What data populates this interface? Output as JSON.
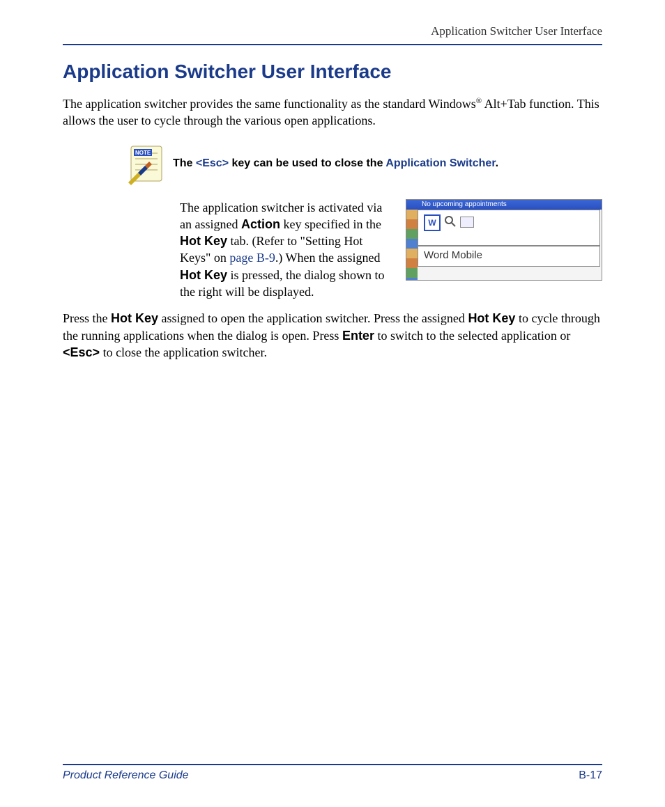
{
  "header": {
    "running_title": "Application Switcher User Interface"
  },
  "title": "Application Switcher User Interface",
  "intro": {
    "pre": "The application switcher provides the same functionality as the standard Win­dows",
    "reg": "®",
    "post": " Alt+Tab function. This allows the user to cycle through the various open applications."
  },
  "note": {
    "t1": "The ",
    "esc": "<Esc>",
    "t2": " key can be used to close the ",
    "appsw": "Application Switcher",
    "t3": "."
  },
  "para2": {
    "s1": "The application switcher is activated via an assigned ",
    "action": "Action",
    "s2": " key specified in the ",
    "hk1": "Hot Key",
    "s3": " tab. (Refer to \"Setting Hot Keys\" on ",
    "pageref": "page B-9",
    "s4": ".) When the assigned ",
    "hk2": "Hot Key",
    "s5": " is pressed, the dialog shown to the right will be displayed."
  },
  "screenshot": {
    "topbar": "No upcoming appointments",
    "selected": "Word Mobile"
  },
  "para3": {
    "s1": "Press the ",
    "hk1": "Hot Key",
    "s2": " assigned to open the application switcher. Press the assigned ",
    "hk2": "Hot Key",
    "s3": " to cycle through the running applications when the dialog is open. Press ",
    "enter": "Enter",
    "s4": " to switch to the selected application or ",
    "esc": "<Esc>",
    "s5": " to close the applica­tion switcher."
  },
  "footer": {
    "guide": "Product Reference Guide",
    "pagenum": "B-17"
  }
}
